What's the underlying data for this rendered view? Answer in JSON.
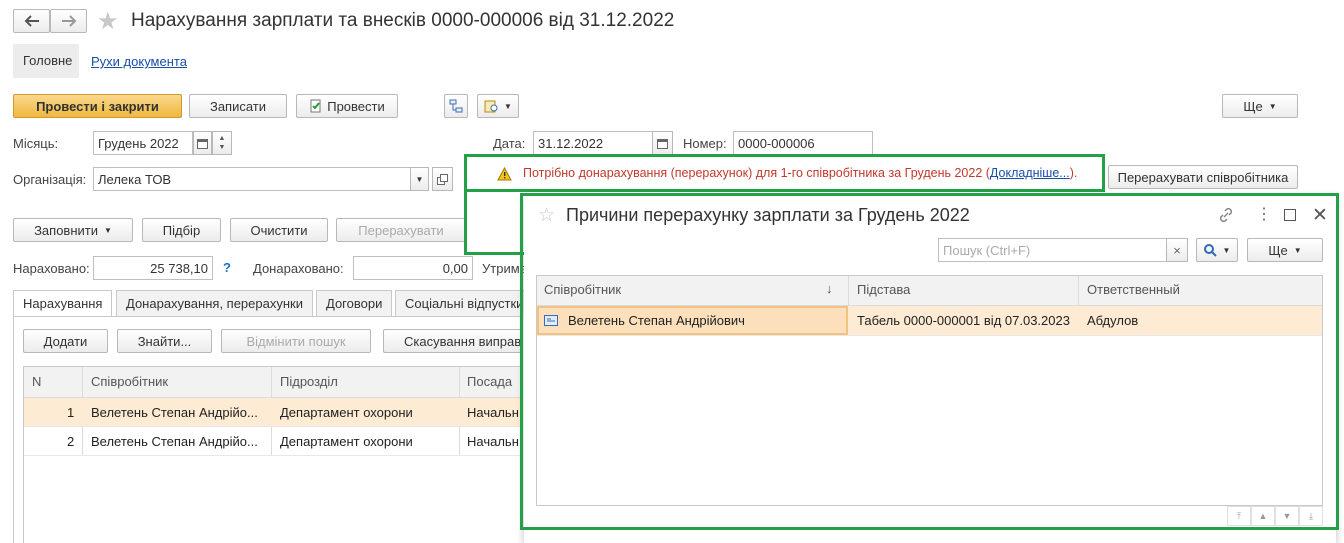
{
  "header": {
    "title": "Нарахування зарплати та внесків 0000-000006 від 31.12.2022",
    "nav_tabs": [
      "Головне",
      "Рухи документа"
    ]
  },
  "toolbar": {
    "post_close": "Провести і закрити",
    "save": "Записати",
    "post": "Провести",
    "more": "Ще"
  },
  "form": {
    "month_label": "Місяць:",
    "month_value": "Грудень 2022",
    "date_label": "Дата:",
    "date_value": "31.12.2022",
    "number_label": "Номер:",
    "number_value": "0000-000006",
    "org_label": "Організація:",
    "org_value": "Лелека ТОВ"
  },
  "warning": {
    "text": "Потрібно донарахування (перерахунок) для 1-го співробітника за Грудень 2022 (",
    "link": "Докладніше...",
    "suffix": ").",
    "recalc_employee": "Перерахувати співробітника"
  },
  "actions": {
    "fill": "Заповнити",
    "select": "Підбір",
    "clear": "Очистити",
    "recalc": "Перерахувати"
  },
  "totals": {
    "accrued_label": "Нараховано:",
    "accrued_value": "25 738,10",
    "help": "?",
    "additional_label": "Донараховано:",
    "additional_value": "0,00",
    "withheld_label": "Утрима"
  },
  "tabs": [
    "Нарахування",
    "Донарахування, перерахунки",
    "Договори",
    "Соціальні відпустки"
  ],
  "table_toolbar": {
    "add": "Додати",
    "find": "Знайти...",
    "cancel_search": "Відмінити пошук",
    "cancel_fix": "Скасування виправ"
  },
  "main_table": {
    "headers": [
      "N",
      "Співробітник",
      "Підрозділ",
      "Посада"
    ],
    "rows": [
      [
        "1",
        "Велетень Степан Андрійо...",
        "Департамент охорони",
        "Начальн"
      ],
      [
        "2",
        "Велетень Степан Андрійо...",
        "Департамент охорони",
        "Начальн"
      ]
    ]
  },
  "popup": {
    "title": "Причини перерахунку зарплати за Грудень 2022",
    "search_placeholder": "Пошук (Ctrl+F)",
    "clear_x": "×",
    "more": "Ще",
    "headers": [
      "Співробітник",
      "Підстава",
      "Ответственный"
    ],
    "sort_arrow": "↓",
    "rows": [
      [
        "Велетень Степан Андрійович",
        "Табель 0000-000001 від 07.03.2023",
        "Абдулов"
      ]
    ]
  },
  "colors": {
    "highlight_green": "#24a148",
    "primary_button": "#f0b840",
    "warning_text": "#c0392b",
    "selected_row": "#fdebd4",
    "link": "#1a4ea8"
  }
}
